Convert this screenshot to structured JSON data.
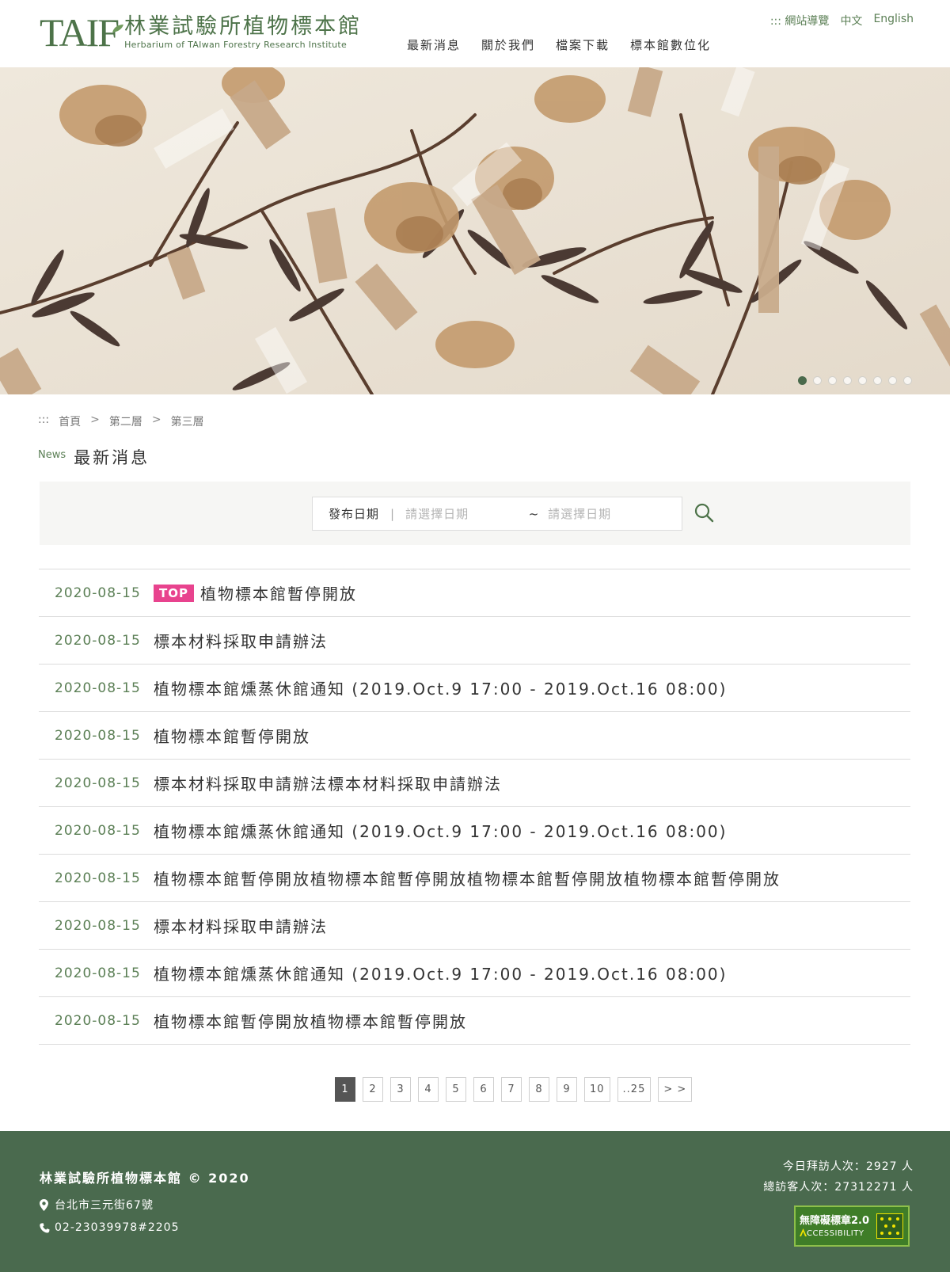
{
  "brand": {
    "logo_text": "TAIF",
    "name_zh": "林業試驗所植物標本館",
    "name_en": "Herbarium of TAIwan Forestry Research Institute"
  },
  "utility_nav": {
    "sitemap": "::: 網站導覽",
    "lang_zh": "中文",
    "lang_en": "English"
  },
  "main_nav": [
    "最新消息",
    "關於我們",
    "檔案下載",
    "標本館數位化"
  ],
  "banner": {
    "slide_count": 8,
    "active_slide": 1
  },
  "breadcrumb": {
    "marker": ":::",
    "items": [
      "首頁",
      "第二層",
      "第三層"
    ],
    "separator": ">"
  },
  "page_heading": {
    "en": "News",
    "zh": "最新消息"
  },
  "search": {
    "label": "發布日期",
    "divider": "|",
    "start_placeholder": "請選擇日期",
    "range_sep": "~",
    "end_placeholder": "請選擇日期"
  },
  "news": [
    {
      "date": "2020-08-15",
      "badge": "TOP",
      "title": "植物標本館暫停開放"
    },
    {
      "date": "2020-08-15",
      "badge": "",
      "title": "標本材料採取申請辦法"
    },
    {
      "date": "2020-08-15",
      "badge": "",
      "title": "植物標本館燻蒸休館通知 (2019.Oct.9 17:00 - 2019.Oct.16 08:00)"
    },
    {
      "date": "2020-08-15",
      "badge": "",
      "title": "植物標本館暫停開放"
    },
    {
      "date": "2020-08-15",
      "badge": "",
      "title": "標本材料採取申請辦法標本材料採取申請辦法"
    },
    {
      "date": "2020-08-15",
      "badge": "",
      "title": "植物標本館燻蒸休館通知 (2019.Oct.9 17:00 - 2019.Oct.16 08:00)"
    },
    {
      "date": "2020-08-15",
      "badge": "",
      "title": "植物標本館暫停開放植物標本館暫停開放植物標本館暫停開放植物標本館暫停開放"
    },
    {
      "date": "2020-08-15",
      "badge": "",
      "title": "標本材料採取申請辦法"
    },
    {
      "date": "2020-08-15",
      "badge": "",
      "title": "植物標本館燻蒸休館通知 (2019.Oct.9 17:00 - 2019.Oct.16 08:00)"
    },
    {
      "date": "2020-08-15",
      "badge": "",
      "title": "植物標本館暫停開放植物標本館暫停開放"
    }
  ],
  "pagination": {
    "current": "1",
    "pages": [
      "1",
      "2",
      "3",
      "4",
      "5",
      "6",
      "7",
      "8",
      "9",
      "10",
      "..25",
      "> >"
    ]
  },
  "footer": {
    "title": "林業試驗所植物標本館 © 2020",
    "address": "台北市三元街67號",
    "phone": "02-23039978#2205",
    "visitors_today": "今日拜訪人次：2927 人",
    "visitors_total": "總訪客人次：27312271 人",
    "accessibility_badge_zh": "無障礙標章2.0",
    "accessibility_badge_en": "CCESSIBILITY"
  },
  "colors": {
    "brand_green": "#4d7349",
    "footer_bg": "#4a6a4e",
    "top_badge": "#e8438e"
  }
}
